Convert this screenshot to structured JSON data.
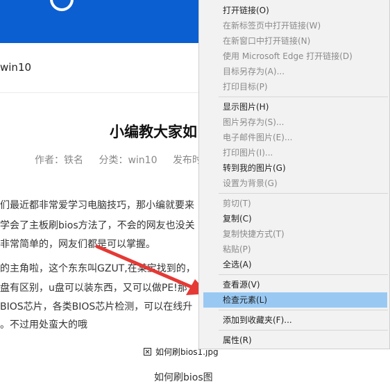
{
  "page": {
    "breadcrumb": "win10",
    "article": {
      "title": "小编教大家如",
      "meta": {
        "author": "作者：铁名",
        "category": "分类：win10",
        "published": "发布时"
      },
      "paragraphs": [
        "们最近都非常爱学习电脑技巧，那小编就要来",
        "学会了主板刷bios方法了，不会的网友也没关",
        "非常简单的，网友们都是可以掌握。",
        "的主角啦，这个东东叫GZUT,在某宝找到的，",
        "盘有区别，u盘可以装东西，又可以做PE!那",
        "BIOS芯片，各类BIOS芯片检测，可以在线升",
        "。不过用处蛮大的哦"
      ],
      "image_caption": "如何刷bios1.jpg",
      "bottom_fragment": "如何刷bios图"
    }
  },
  "context_menu": {
    "groups": [
      [
        {
          "label": "打开链接(O)",
          "enabled": true
        },
        {
          "label": "在新标签页中打开链接(W)",
          "enabled": false
        },
        {
          "label": "在新窗口中打开链接(N)",
          "enabled": false
        },
        {
          "label": "使用 Microsoft Edge 打开链接(D)",
          "enabled": false
        },
        {
          "label": "目标另存为(A)...",
          "enabled": false
        },
        {
          "label": "打印目标(P)",
          "enabled": false
        }
      ],
      [
        {
          "label": "显示图片(H)",
          "enabled": true
        },
        {
          "label": "图片另存为(S)...",
          "enabled": false
        },
        {
          "label": "电子邮件图片(E)...",
          "enabled": false
        },
        {
          "label": "打印图片(I)...",
          "enabled": false
        },
        {
          "label": "转到我的图片(G)",
          "enabled": true
        },
        {
          "label": "设置为背景(G)",
          "enabled": false
        }
      ],
      [
        {
          "label": "剪切(T)",
          "enabled": false
        },
        {
          "label": "复制(C)",
          "enabled": true
        },
        {
          "label": "复制快捷方式(T)",
          "enabled": false
        },
        {
          "label": "粘贴(P)",
          "enabled": false
        },
        {
          "label": "全选(A)",
          "enabled": true
        }
      ],
      [
        {
          "label": "查看源(V)",
          "enabled": true
        },
        {
          "label": "检查元素(L)",
          "enabled": true,
          "highlighted": true
        }
      ],
      [
        {
          "label": "添加到收藏夹(F)...",
          "enabled": true
        }
      ],
      [
        {
          "label": "属性(R)",
          "enabled": true
        }
      ]
    ]
  },
  "colors": {
    "header_blue": "#0b5fd1",
    "menu_highlight": "#99c9f3",
    "arrow_red": "#e53935"
  }
}
